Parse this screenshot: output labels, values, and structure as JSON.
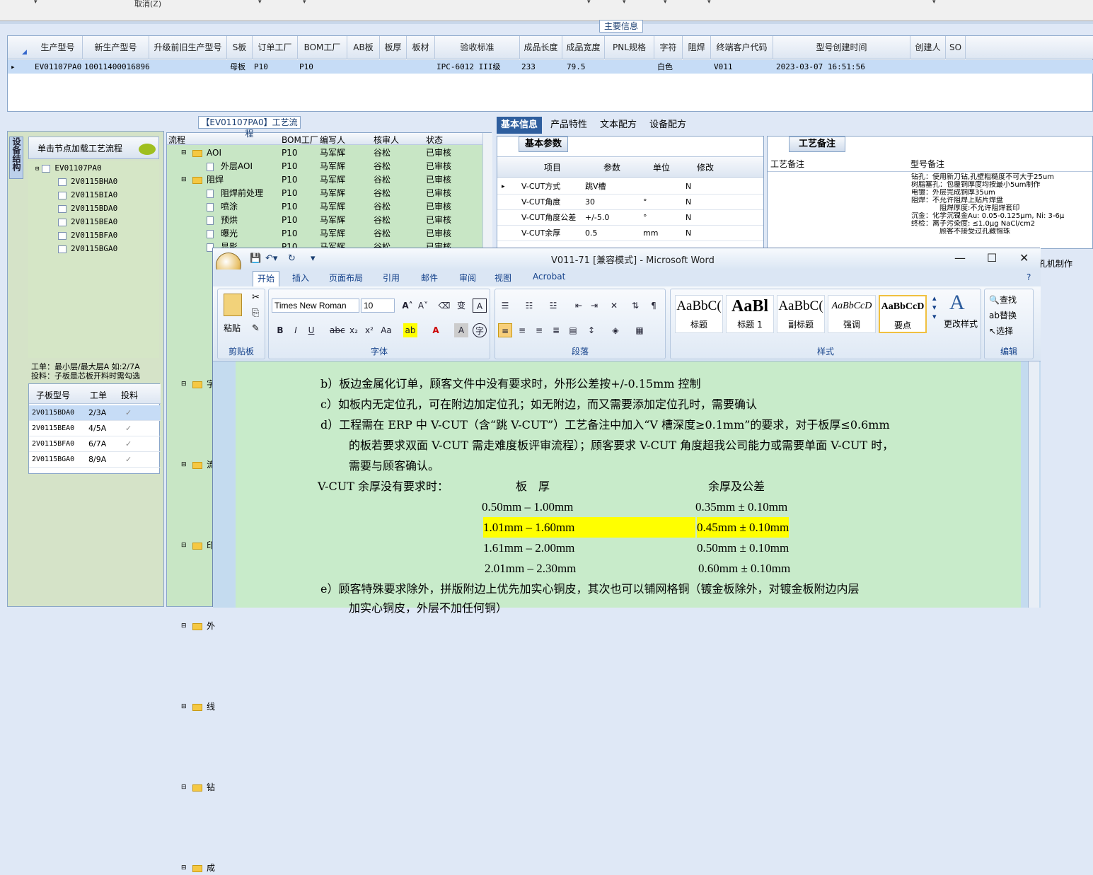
{
  "topbar": {
    "cancel": "取消(Z)"
  },
  "main_info": {
    "tab": "主要信息",
    "columns": [
      "生产型号",
      "新生产型号",
      "升级前旧生产型号",
      "S板",
      "订单工厂",
      "BOM工厂",
      "AB板",
      "板厚",
      "板材",
      "验收标准",
      "成品长度",
      "成品宽度",
      "PNL规格",
      "字符",
      "阻焊",
      "终端客户代码",
      "型号创建时间",
      "创建人",
      "SO"
    ],
    "row": {
      "pointer": "▸",
      "c1": "EV01107PA0",
      "c2": "10011400016896",
      "c4": "母板",
      "c5": "P10",
      "c6": "P10",
      "c10": "IPC-6012 III级",
      "c11": "233",
      "c12": "79.5",
      "c14": "白色",
      "c16": "V011",
      "c17": "2023-03-07 16:51:56"
    }
  },
  "left": {
    "vtab": "设备结构",
    "load_btn": "单击节点加载工艺流程",
    "tree_root": "EV01107PA0",
    "tree_children": [
      "2V0115BHA0",
      "2V0115BIA0",
      "2V0115BDA0",
      "2V0115BEA0",
      "2V0115BFA0",
      "2V0115BGA0"
    ],
    "note1": "工单：最小层/最大层A 如:2/7A",
    "note2": "投料：子板是芯板开料时需勾选",
    "sub_cols": [
      "子板型号",
      "工单",
      "投料"
    ],
    "sub_rows": [
      [
        "2V0115BDA0",
        "2/3A"
      ],
      [
        "2V0115BEA0",
        "4/5A"
      ],
      [
        "2V0115BFA0",
        "6/7A"
      ],
      [
        "2V0115BGA0",
        "8/9A"
      ]
    ],
    "check": "✓"
  },
  "flow": {
    "title": "【EV01107PA0】工艺流程",
    "cols": [
      "流程",
      "BOM工厂",
      "编写人",
      "核审人",
      "状态"
    ],
    "rows": [
      {
        "name": "AOI",
        "type": "folder",
        "bom": "P10",
        "writer": "马军辉",
        "checker": "谷松",
        "status": "已审核"
      },
      {
        "name": "外层AOI",
        "type": "doc",
        "bom": "P10",
        "writer": "马军辉",
        "checker": "谷松",
        "status": "已审核"
      },
      {
        "name": "阻焊",
        "type": "folder",
        "bom": "P10",
        "writer": "马军辉",
        "checker": "谷松",
        "status": "已审核"
      },
      {
        "name": "阻焊前处理",
        "type": "doc",
        "bom": "P10",
        "writer": "马军辉",
        "checker": "谷松",
        "status": "已审核"
      },
      {
        "name": "喷涂",
        "type": "doc",
        "bom": "P10",
        "writer": "马军辉",
        "checker": "谷松",
        "status": "已审核"
      },
      {
        "name": "预烘",
        "type": "doc",
        "bom": "P10",
        "writer": "马军辉",
        "checker": "谷松",
        "status": "已审核"
      },
      {
        "name": "曝光",
        "type": "doc",
        "bom": "P10",
        "writer": "马军辉",
        "checker": "谷松",
        "status": "已审核"
      },
      {
        "name": "显影",
        "type": "doc",
        "bom": "P10",
        "writer": "马军辉",
        "checker": "谷松",
        "status": "已审核"
      }
    ],
    "partial": [
      "字",
      "流",
      "印",
      "外",
      "线",
      "钻",
      "成"
    ]
  },
  "right": {
    "tabs": [
      "基本信息",
      "产品特性",
      "文本配方",
      "设备配方"
    ],
    "basic_title": "基本参数",
    "basic_cols": [
      "项目",
      "参数",
      "单位",
      "修改"
    ],
    "basic_rows": [
      [
        "V-CUT方式",
        "跳V槽",
        "",
        "N"
      ],
      [
        "V-CUT角度",
        "30",
        "°",
        "N"
      ],
      [
        "V-CUT角度公差",
        "+/-5.0",
        "°",
        "N"
      ],
      [
        "V-CUT余厚",
        "0.5",
        "mm",
        "N"
      ]
    ],
    "note_title": "工艺备注",
    "note_cols": [
      "工艺备注",
      "型号备注"
    ],
    "note_lines": [
      "钻孔：使用新刀钻,孔壁粗糙度不可大于25um",
      "树脂塞孔：包覆铜厚度均按最小5um制作",
      "电镀：外层完成铜厚35um",
      "阻焊：不允许阻焊上贴片焊盘",
      "阻焊厚度:不允许阻焊套印",
      "沉金：化学沉镍金Au: 0.05-0.125μm, Ni: 3-6μ",
      "终检：离子污染度: ≤1.0μg NaCl/cm2",
      "顾客不接受过孔藏锡珠"
    ],
    "behind": "孔机制作"
  },
  "word": {
    "title": "V011-71 [兼容模式] - Microsoft Word",
    "ribbon_tabs": [
      "开始",
      "插入",
      "页面布局",
      "引用",
      "邮件",
      "审阅",
      "视图",
      "Acrobat"
    ],
    "font": "Times New Roman",
    "size": "10",
    "groups": {
      "clipboard": "剪贴板",
      "font": "字体",
      "paragraph": "段落",
      "styles": "样式",
      "edit": "编辑"
    },
    "paste": "粘贴",
    "styles": [
      {
        "s": "AaBbC(",
        "n": "标题"
      },
      {
        "s": "AaBl",
        "n": "标题 1"
      },
      {
        "s": "AaBbC(",
        "n": "副标题"
      },
      {
        "s": "AaBbCcD",
        "n": "强调"
      },
      {
        "s": "AaBbCcD",
        "n": "要点"
      }
    ],
    "change_styles": "更改样式",
    "edit": [
      "查找",
      "替换",
      "选择"
    ],
    "doc": {
      "lb": "b）板边金属化订单，顾客文件中没有要求时，外形公差按+/-0.15mm 控制",
      "lc": "c）如板内无定位孔，可在附边加定位孔；如无附边，而又需要添加定位孔时，需要确认",
      "ld1": "d）工程需在 ERP 中 V-CUT（含“跳 V-CUT”）工艺备注中加入“V 槽深度≥0.1mm”的要求，对于板厚≤0.6mm",
      "ld2": "的板若要求双面 V-CUT 需走难度板评审流程）；顾客要求 V-CUT 角度超我公司能力或需要单面 V-CUT 时，",
      "ld3": "需要与顾客确认。",
      "vh1": "V-CUT 余厚没有要求时：",
      "vh2": "板　厚",
      "vh3": "余厚及公差",
      "rows": [
        [
          "0.50mm – 1.00mm",
          "0.35mm ± 0.10mm"
        ],
        [
          "1.01mm – 1.60mm",
          "0.45mm ± 0.10mm"
        ],
        [
          "1.61mm – 2.00mm",
          "0.50mm ± 0.10mm"
        ],
        [
          "2.01mm – 2.30mm",
          "0.60mm ± 0.10mm"
        ]
      ],
      "le": "e）顾客特殊要求除外，拼版附边上优先加实心铜皮，其次也可以铺网格铜（镀金板除外，对镀金板附边内层",
      "le2": "加实心铜皮，外层不加任何铜）"
    }
  },
  "colors": {
    "highlight": "#ffff00",
    "green": "#c8ebca",
    "tab_active": "#2e5e9e"
  }
}
